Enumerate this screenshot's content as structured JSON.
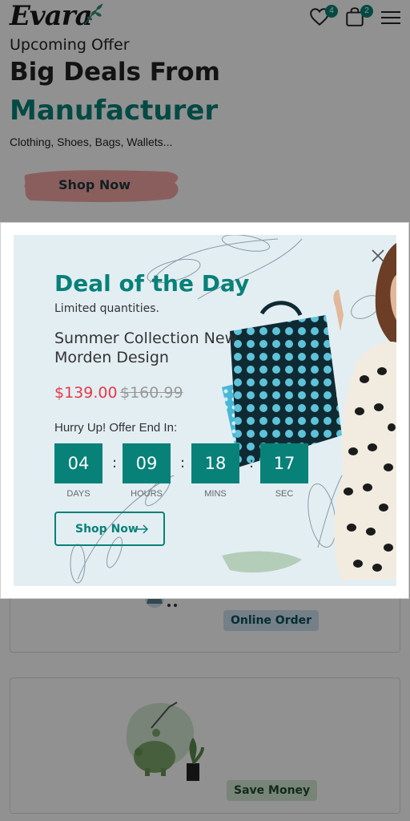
{
  "header": {
    "logo_text": "Evara",
    "wishlist_count": "4",
    "cart_count": "2"
  },
  "hero": {
    "kicker": "Upcoming Offer",
    "title_line1": "Big Deals From",
    "title_line2": "Manufacturer",
    "subtitle": "Clothing, Shoes, Bags, Wallets...",
    "button_label": "Shop Now"
  },
  "features": [
    {
      "label": "Online Order",
      "badge_color": "#cde0ee"
    },
    {
      "label": "Save Money",
      "badge_color": "#d1e8d2"
    }
  ],
  "modal": {
    "title": "Deal of the Day",
    "subtitle": "Limited quantities.",
    "description": "Summer Collection New\nMorden Design",
    "price_new": "$139.00",
    "price_old": "$160.99",
    "hurry_text": "Hurry Up! Offer End In:",
    "countdown": [
      {
        "value": "04",
        "label": "DAYS"
      },
      {
        "value": "09",
        "label": "HOURS"
      },
      {
        "value": "18",
        "label": "MINS"
      },
      {
        "value": "17",
        "label": "SEC"
      }
    ],
    "button_label": "Shop Now"
  },
  "colors": {
    "brand": "#088178",
    "price": "#e63946"
  }
}
